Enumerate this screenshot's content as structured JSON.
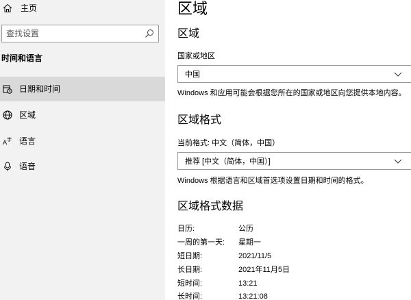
{
  "sidebar": {
    "home_label": "主页",
    "search_placeholder": "查找设置",
    "section_title": "时间和语言",
    "items": [
      {
        "label": "日期和时间",
        "icon": "calendar-clock-icon",
        "selected": true
      },
      {
        "label": "区域",
        "icon": "globe-icon",
        "selected": false
      },
      {
        "label": "语言",
        "icon": "language-icon",
        "selected": false
      },
      {
        "label": "语音",
        "icon": "microphone-icon",
        "selected": false
      }
    ]
  },
  "main": {
    "title": "区域",
    "region_heading": "区域",
    "country_label": "国家或地区",
    "country_value": "中国",
    "country_desc": "Windows 和应用可能会根据您所在的国家或地区向您提供本地内容。",
    "format_heading": "区域格式",
    "current_format_label": "当前格式: 中文（简体，中国）",
    "format_value": "推荐 [中文（简体，中国）]",
    "format_desc": "Windows 根据语言和区域首选项设置日期和时间的格式。",
    "format_data_heading": "区域格式数据",
    "format_data": [
      {
        "key": "日历:",
        "value": "公历"
      },
      {
        "key": "一周的第一天:",
        "value": "星期一"
      },
      {
        "key": "短日期:",
        "value": "2021/11/5"
      },
      {
        "key": "长日期:",
        "value": "2021年11月5日"
      },
      {
        "key": "短时间:",
        "value": "13:21"
      },
      {
        "key": "长时间:",
        "value": "13:21:08"
      }
    ]
  },
  "colors": {
    "sidebar_bg": "#f2f2f2",
    "selected_bg": "#d9d9d9",
    "border": "#999999"
  }
}
